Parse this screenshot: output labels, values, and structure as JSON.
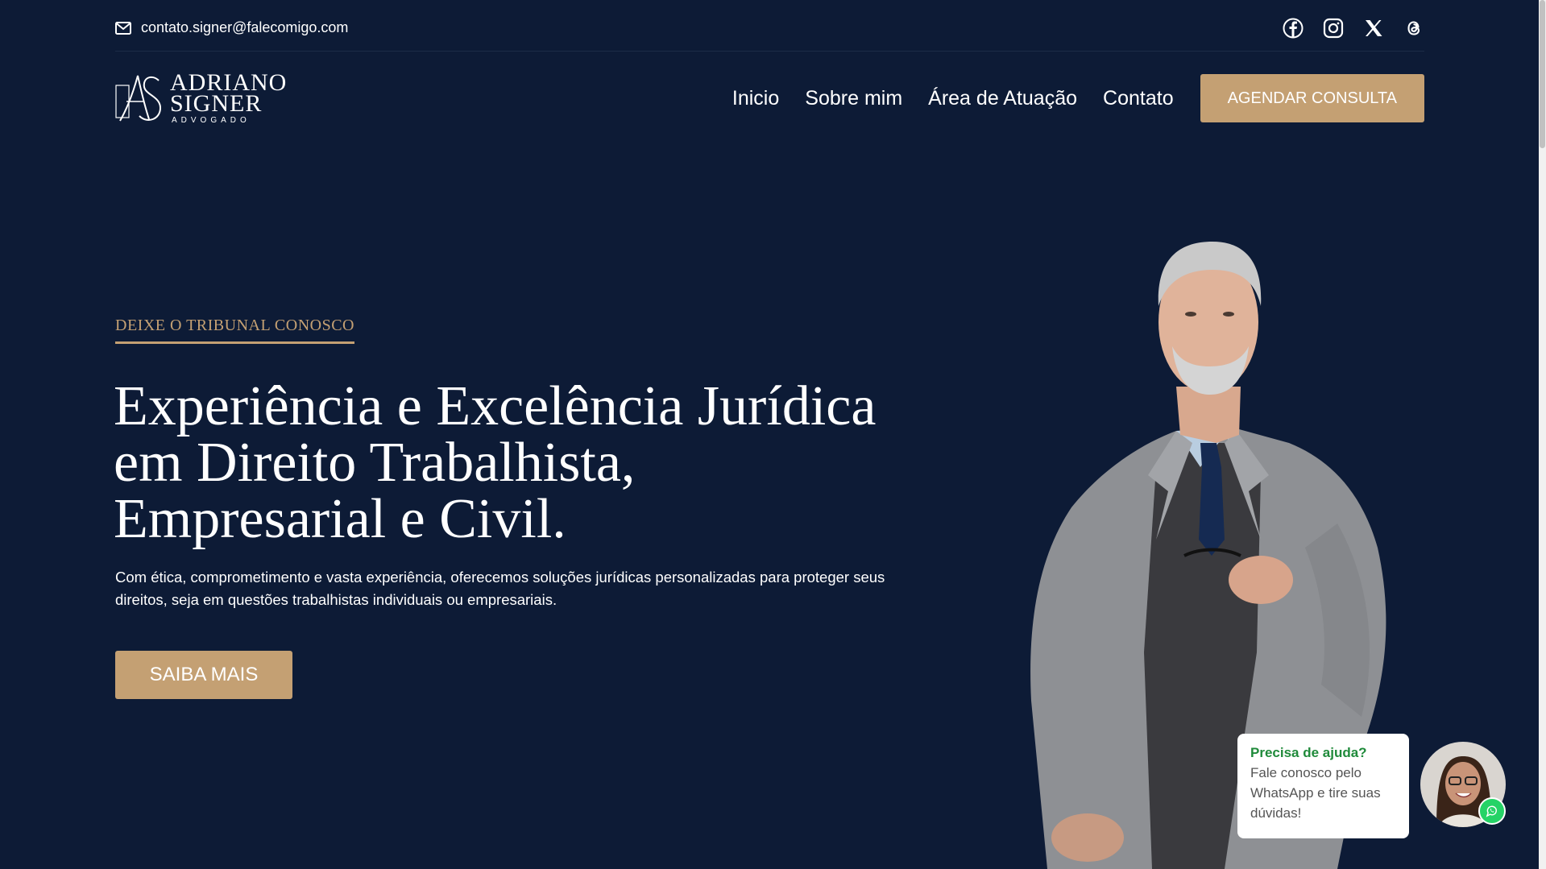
{
  "topbar": {
    "email": "contato.signer@falecomigo.com",
    "social_icons": [
      "facebook-icon",
      "instagram-icon",
      "x-icon",
      "threads-icon"
    ]
  },
  "logo": {
    "line1": "ADRIANO",
    "line2": "SIGNER",
    "subtitle": "ADVOGADO"
  },
  "nav": {
    "links": [
      "Inicio",
      "Sobre mim",
      "Área de Atuação",
      "Contato"
    ],
    "cta": "AGENDAR CONSULTA"
  },
  "hero": {
    "eyebrow": "DEIXE O TRIBUNAL CONOSCO",
    "headline_line1": "Experiência e Excelência Jurídica",
    "headline_line2": "em Direito Trabalhista,",
    "headline_line3": "Empresarial e Civil.",
    "lead": "Com ética, comprometimento e vasta experiência, oferecemos soluções jurídicas personalizadas para proteger seus direitos, seja em questões trabalhistas individuais ou empresariais.",
    "button": "SAIBA MAIS"
  },
  "whatsapp": {
    "title": "Precisa de ajuda?",
    "text": "Fale conosco pelo WhatsApp e tire suas dúvidas!"
  },
  "colors": {
    "background": "#0d1b36",
    "accent": "#c4a073",
    "whatsapp_green": "#25d366"
  }
}
